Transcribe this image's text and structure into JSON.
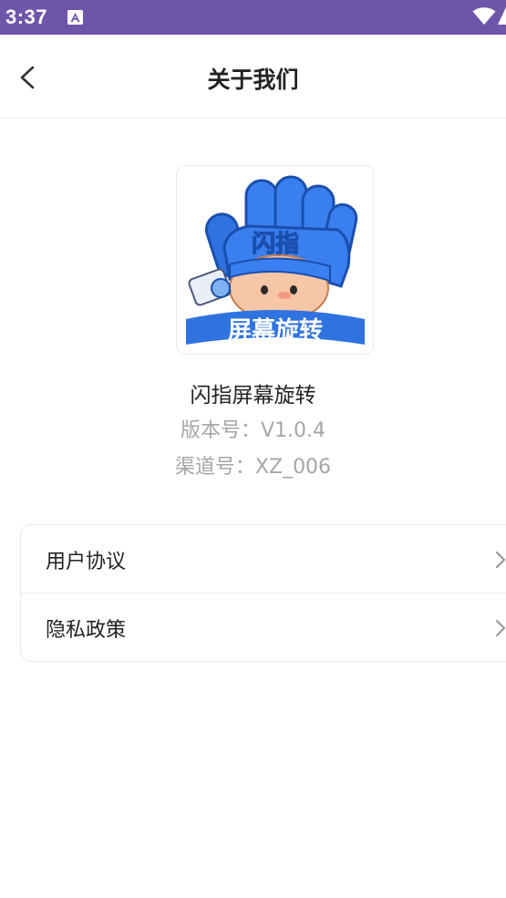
{
  "status_bar": {
    "time": "3:37",
    "background": "#6f55aa",
    "icons": [
      "notification-a-icon",
      "wifi-icon",
      "signal-icon"
    ]
  },
  "app_bar": {
    "title": "关于我们",
    "back_icon": "chevron-left-icon"
  },
  "app_info": {
    "icon_text_top": "闪指",
    "icon_text_bottom": "屏幕旋转",
    "name": "闪指屏幕旋转",
    "version": "版本号：V1.0.4",
    "channel": "渠道号：XZ_006"
  },
  "menu": {
    "items": [
      {
        "label": "用户协议",
        "icon": "chevron-right-icon"
      },
      {
        "label": "隐私政策",
        "icon": "chevron-right-icon"
      }
    ]
  }
}
